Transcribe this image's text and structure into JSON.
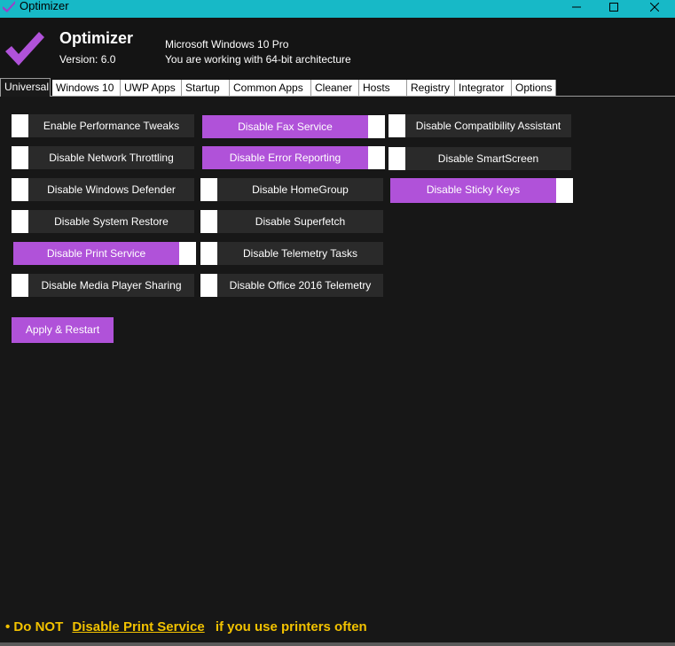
{
  "window": {
    "title": "Optimizer",
    "accent_color": "#17B9C7",
    "minimize_icon": "minimize-icon",
    "maximize_icon": "maximize-icon",
    "close_icon": "close-icon"
  },
  "header": {
    "app_name": "Optimizer",
    "version": "Version: 6.0",
    "os": "Microsoft Windows 10 Pro",
    "architecture": "You are working with 64-bit architecture",
    "logo_icon": "checkmark-icon",
    "logo_color": "#B052D9"
  },
  "tabs": [
    {
      "label": "Universal",
      "active": true
    },
    {
      "label": "Windows 10",
      "active": false
    },
    {
      "label": "UWP Apps",
      "active": false
    },
    {
      "label": "Startup",
      "active": false
    },
    {
      "label": "Common Apps",
      "active": false
    },
    {
      "label": "Cleaner",
      "active": false
    },
    {
      "label": "Hosts",
      "active": false
    },
    {
      "label": "Registry",
      "active": false
    },
    {
      "label": "Integrator",
      "active": false
    },
    {
      "label": "Options",
      "active": false
    }
  ],
  "toggles": {
    "col1": [
      {
        "label": "Enable Performance Tweaks",
        "on": false
      },
      {
        "label": "Disable Network Throttling",
        "on": false
      },
      {
        "label": "Disable Windows Defender",
        "on": false
      },
      {
        "label": "Disable System Restore",
        "on": false
      },
      {
        "label": "Disable Print Service",
        "on": true
      },
      {
        "label": "Disable Media Player Sharing",
        "on": false
      }
    ],
    "col2": [
      {
        "label": "Disable Fax Service",
        "on": true
      },
      {
        "label": "Disable Error Reporting",
        "on": true
      },
      {
        "label": "Disable HomeGroup",
        "on": false
      },
      {
        "label": "Disable Superfetch",
        "on": false
      },
      {
        "label": "Disable Telemetry Tasks",
        "on": false
      },
      {
        "label": "Disable Office 2016 Telemetry",
        "on": false
      }
    ],
    "col3": [
      {
        "label": "Disable Compatibility Assistant",
        "on": false
      },
      {
        "label": "Disable SmartScreen",
        "on": false
      },
      {
        "label": "Disable Sticky Keys",
        "on": true
      }
    ],
    "on_color": "#B052D9",
    "off_color": "#2a2a2a"
  },
  "apply_button": "Apply & Restart",
  "tip": {
    "prefix": "• Do NOT",
    "link": "Disable Print Service",
    "suffix": "if you use printers often",
    "color": "#F2C200"
  }
}
